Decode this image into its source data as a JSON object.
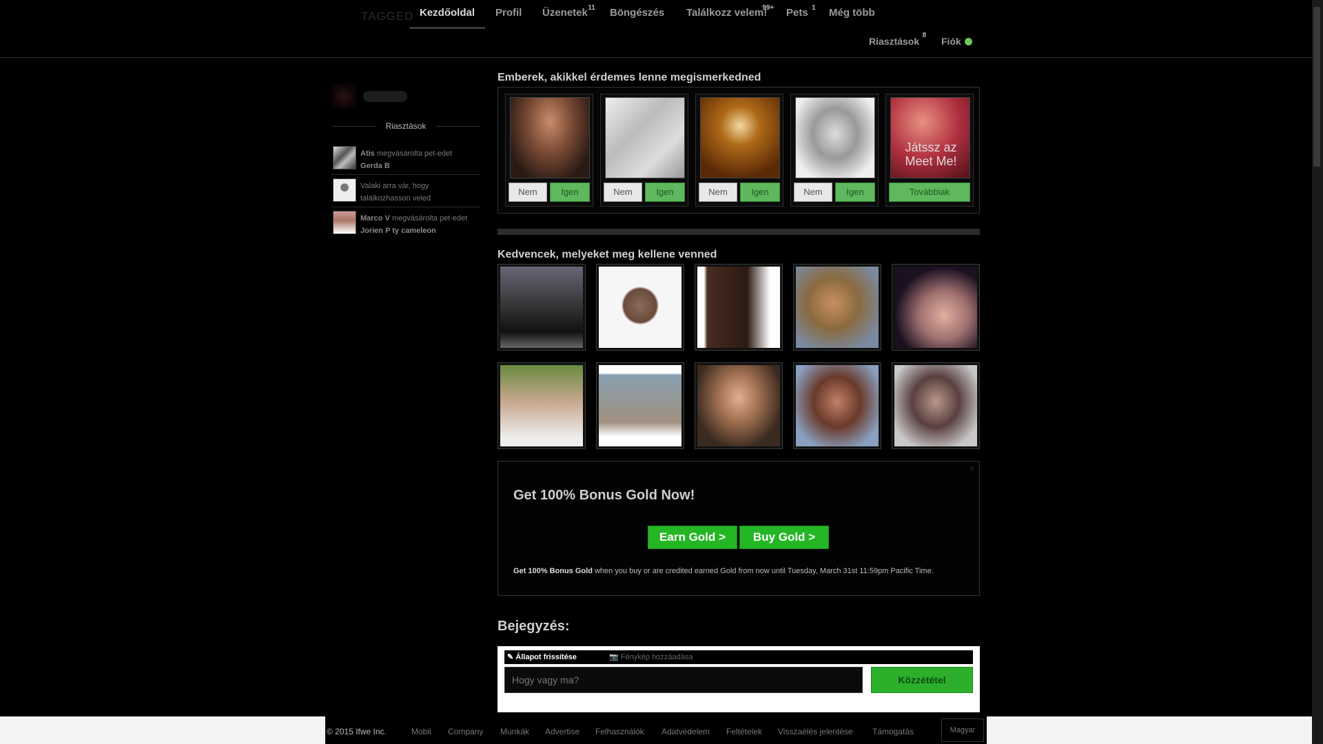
{
  "header": {
    "logo": "TAGGED",
    "nav": [
      {
        "label": "Kezdőoldal",
        "badge": ""
      },
      {
        "label": "Profil",
        "badge": ""
      },
      {
        "label": "Üzenetek",
        "badge": "11"
      },
      {
        "label": "Böngészés",
        "badge": ""
      },
      {
        "label": "Találkozz velem!",
        "badge": "99+"
      },
      {
        "label": "Pets",
        "badge": "1"
      },
      {
        "label": "Még több",
        "badge": ""
      }
    ],
    "alerts_label": "Riasztások",
    "alerts_badge": "8",
    "account_label": "Fiók",
    "online_color": "#6ec85a"
  },
  "sidebar": {
    "title": "Riasztások",
    "items": [
      {
        "line1": "Atis",
        "action": "megvásárolta pet-edet",
        "line2": "Gerda B"
      },
      {
        "line1": "",
        "action": "Valaki arra vár, hogy találkozhasson veled",
        "line2": ""
      },
      {
        "line1": "Marco V",
        "action": "megvásárolta pet-edet",
        "line2": "Jorien P ty cameleon"
      }
    ]
  },
  "meetme": {
    "title": "Emberek, akikkel érdemes lenne megismerkedned",
    "no_label": "Nem",
    "yes_label": "Igen",
    "play_text": "Játssz az Meet Me!",
    "more_label": "Továbbiak"
  },
  "favorites": {
    "title": "Kedvencek, melyeket meg kellene venned"
  },
  "ad": {
    "close": "x",
    "title": "Get 100% Bonus Gold Now!",
    "earn_label": "Earn Gold >",
    "buy_label": "Buy Gold >",
    "text_bold": "Get 100% Bonus Gold",
    "text_rest": " when you buy or are credited earned Gold from now until Tuesday, March 31st 11:59pm Pacific Time.",
    "accent": "#25b625"
  },
  "post": {
    "title": "Bejegyzés:",
    "tab_status": "Állapot frissítése",
    "tab_photo": "Fénykép hozzáadása",
    "placeholder": "Hogy vagy ma?",
    "submit": "Közzététel"
  },
  "footer": {
    "copyright": "© 2015 Ifwe Inc.",
    "links": [
      "Mobil",
      "Company",
      "Munkák",
      "Advertise",
      "Felhasználók",
      "Adatvédelem",
      "Feltételek",
      "Visszaélés jelentése",
      "Támogatás"
    ],
    "language": "Magyar"
  }
}
